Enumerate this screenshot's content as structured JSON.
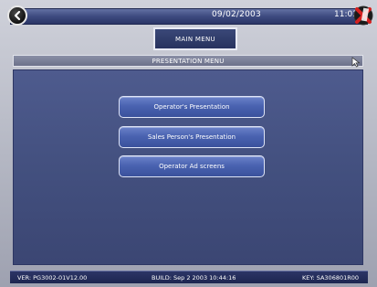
{
  "header": {
    "date": "09/02/2003",
    "time": "11:02"
  },
  "nav": {
    "main_menu_label": "MAIN MENU"
  },
  "section": {
    "title": "PRESENTATION MENU"
  },
  "menu": {
    "items": [
      {
        "label": "Operator's Presentation"
      },
      {
        "label": "Sales Person's Presentation"
      },
      {
        "label": "Operator Ad screens"
      }
    ]
  },
  "footer": {
    "version": "VER: PG3002-01V12.00",
    "build": "BUILD: Sep 2 2003 10:44:16",
    "key": "KEY: SA306801R00"
  },
  "icons": {
    "back": "back-arrow-icon",
    "close": "close-x-icon",
    "cursor": "mouse-cursor-icon"
  },
  "colors": {
    "panel": "#46528a",
    "button": "#4a63b1",
    "header_bar": "#3d4a80",
    "close_red": "#d62020"
  }
}
